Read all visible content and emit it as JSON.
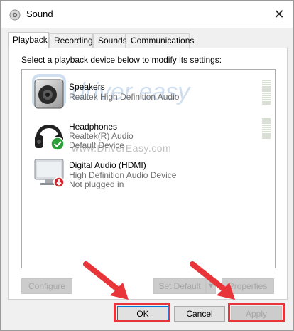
{
  "window": {
    "title": "Sound",
    "icon": "speaker-icon",
    "close_symbol": "✕"
  },
  "tabs": [
    {
      "label": "Playback",
      "active": true
    },
    {
      "label": "Recording",
      "active": false
    },
    {
      "label": "Sounds",
      "active": false
    },
    {
      "label": "Communications",
      "active": false
    }
  ],
  "playback": {
    "instruction": "Select a playback device below to modify its settings:",
    "devices": [
      {
        "name": "Speakers",
        "line1": "Realtek High Definition Audio",
        "line2": "",
        "icon": "speaker-device-icon",
        "status_icon": ""
      },
      {
        "name": "Headphones",
        "line1": "Realtek(R) Audio",
        "line2": "Default Device",
        "icon": "headphones-icon",
        "status_icon": "default-check-icon"
      },
      {
        "name": "Digital Audio (HDMI)",
        "line1": "High Definition Audio Device",
        "line2": "Not plugged in",
        "icon": "monitor-icon",
        "status_icon": "unplugged-arrow-icon"
      }
    ],
    "watermark": {
      "logo_text": "driver easy",
      "url_text": "www.DriverEasy.com"
    }
  },
  "buttons": {
    "configure": "Configure",
    "set_default": "Set Default",
    "properties": "Properties",
    "ok": "OK",
    "cancel": "Cancel",
    "apply": "Apply"
  },
  "colors": {
    "highlight": "#e8353a",
    "check": "#2d9e3a",
    "unplugged": "#c8262b"
  }
}
